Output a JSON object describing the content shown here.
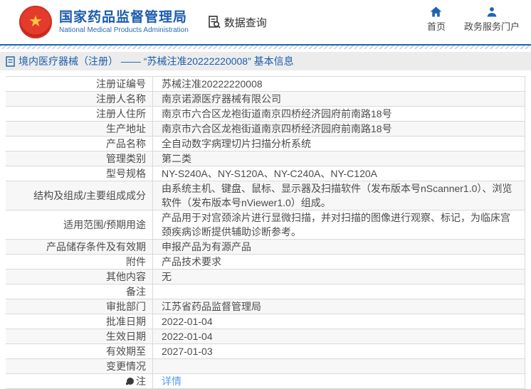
{
  "header": {
    "title": "国家药品监督管理局",
    "subtitle": "National Medical Products Administration",
    "data_query_label": "数据查询",
    "nav_home_label": "首页",
    "nav_portal_label": "政务服务门户"
  },
  "breadcrumb": {
    "text": "境内医疗器械（注册） —— “苏械注准20222220008” 基本信息"
  },
  "table": {
    "rows": [
      {
        "label": "注册证编号",
        "value": "苏械注准20222220008"
      },
      {
        "label": "注册人名称",
        "value": "南京诺源医疗器械有限公司"
      },
      {
        "label": "注册人住所",
        "value": "南京市六合区龙袍街道南京四桥经济园府前南路18号"
      },
      {
        "label": "生产地址",
        "value": "南京市六合区龙袍街道南京四桥经济园府前南路18号"
      },
      {
        "label": "产品名称",
        "value": "全自动数字病理切片扫描分析系统"
      },
      {
        "label": "管理类别",
        "value": "第二类"
      },
      {
        "label": "型号规格",
        "value": "NY-S240A、NY-S120A、NY-C240A、NY-C120A"
      },
      {
        "label": "结构及组成/主要组成成分",
        "value": "由系统主机、键盘、鼠标、显示器及扫描软件（发布版本号nScanner1.0）、浏览软件（发布版本号nViewer1.0）组成。"
      },
      {
        "label": "适用范围/预期用途",
        "value": "产品用于对宫颈涂片进行显微扫描，并对扫描的图像进行观察、标记，为临床宫颈疾病诊断提供辅助诊断参考。"
      },
      {
        "label": "产品储存条件及有效期",
        "value": "申报产品为有源产品"
      },
      {
        "label": "附件",
        "value": "产品技术要求"
      },
      {
        "label": "其他内容",
        "value": "无"
      },
      {
        "label": "备注",
        "value": ""
      },
      {
        "label": "审批部门",
        "value": "江苏省药品监督管理局"
      },
      {
        "label": "批准日期",
        "value": "2022-01-04"
      },
      {
        "label": "生效日期",
        "value": "2022-01-04"
      },
      {
        "label": "有效期至",
        "value": "2027-01-03"
      },
      {
        "label": "变更情况",
        "value": ""
      },
      {
        "label": "注",
        "value": "详情"
      }
    ]
  },
  "icons": {
    "emblem": "national-emblem",
    "data_query": "document-search-icon",
    "nav_home": "home-icon",
    "nav_portal": "user-icon",
    "breadcrumb": "document-icon",
    "note": "note-icon"
  },
  "colors": {
    "brand_blue": "#1b5cab",
    "nav_icon_blue": "#2063b4",
    "link_blue": "#55a1e8",
    "breadcrumb_bg": "#ececec",
    "row_alt_bg": "#f7f7f7",
    "border_gray": "#d9d9d9",
    "emblem_red": "#d8281e",
    "emblem_gold": "#f6c93f"
  }
}
